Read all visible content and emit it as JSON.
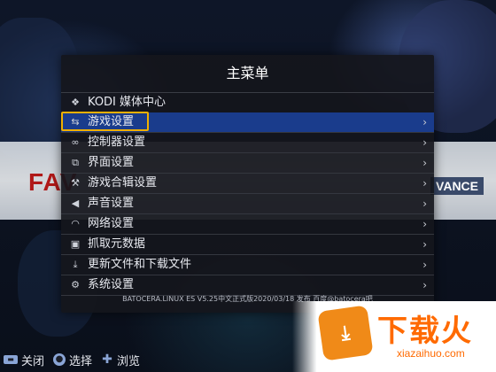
{
  "menu": {
    "title": "主菜单",
    "items": [
      {
        "label": "KODI 媒体中心",
        "icon": "kodi-icon",
        "glyph": "❖",
        "chevron": ""
      },
      {
        "label": "游戏设置",
        "icon": "game-settings-icon",
        "glyph": "⇆",
        "chevron": "›"
      },
      {
        "label": "控制器设置",
        "icon": "controller-icon",
        "glyph": "∞",
        "chevron": "›"
      },
      {
        "label": "界面设置",
        "icon": "interface-icon",
        "glyph": "⧉",
        "chevron": "›"
      },
      {
        "label": "游戏合辑设置",
        "icon": "wrench-icon",
        "glyph": "⚒",
        "chevron": "›"
      },
      {
        "label": "声音设置",
        "icon": "speaker-icon",
        "glyph": "◀",
        "chevron": "›"
      },
      {
        "label": "网络设置",
        "icon": "wifi-icon",
        "glyph": "◠",
        "chevron": "›"
      },
      {
        "label": "抓取元数据",
        "icon": "scrape-icon",
        "glyph": "▣",
        "chevron": "›"
      },
      {
        "label": "更新文件和下载文件",
        "icon": "download-icon",
        "glyph": "⤓",
        "chevron": "›"
      },
      {
        "label": "系统设置",
        "icon": "gears-icon",
        "glyph": "⚙",
        "chevron": "›"
      }
    ],
    "selected_index": 1,
    "footer": "BATOCERA.LINUX ES V5.25中文正式版2020/03/18 发布 百度@batocera吧"
  },
  "helpbar": {
    "close_label": "关闭",
    "select_label": "选择",
    "browse_label": "浏览"
  },
  "background": {
    "left_text": "FAV",
    "right_text": "VANCE"
  },
  "watermark": {
    "title": "下载火",
    "url": "xiazaihuo.com"
  },
  "colors": {
    "selected_bg": "#1a3c8c",
    "focus_outline": "#f0b000",
    "watermark_orange": "#ff6a00"
  }
}
